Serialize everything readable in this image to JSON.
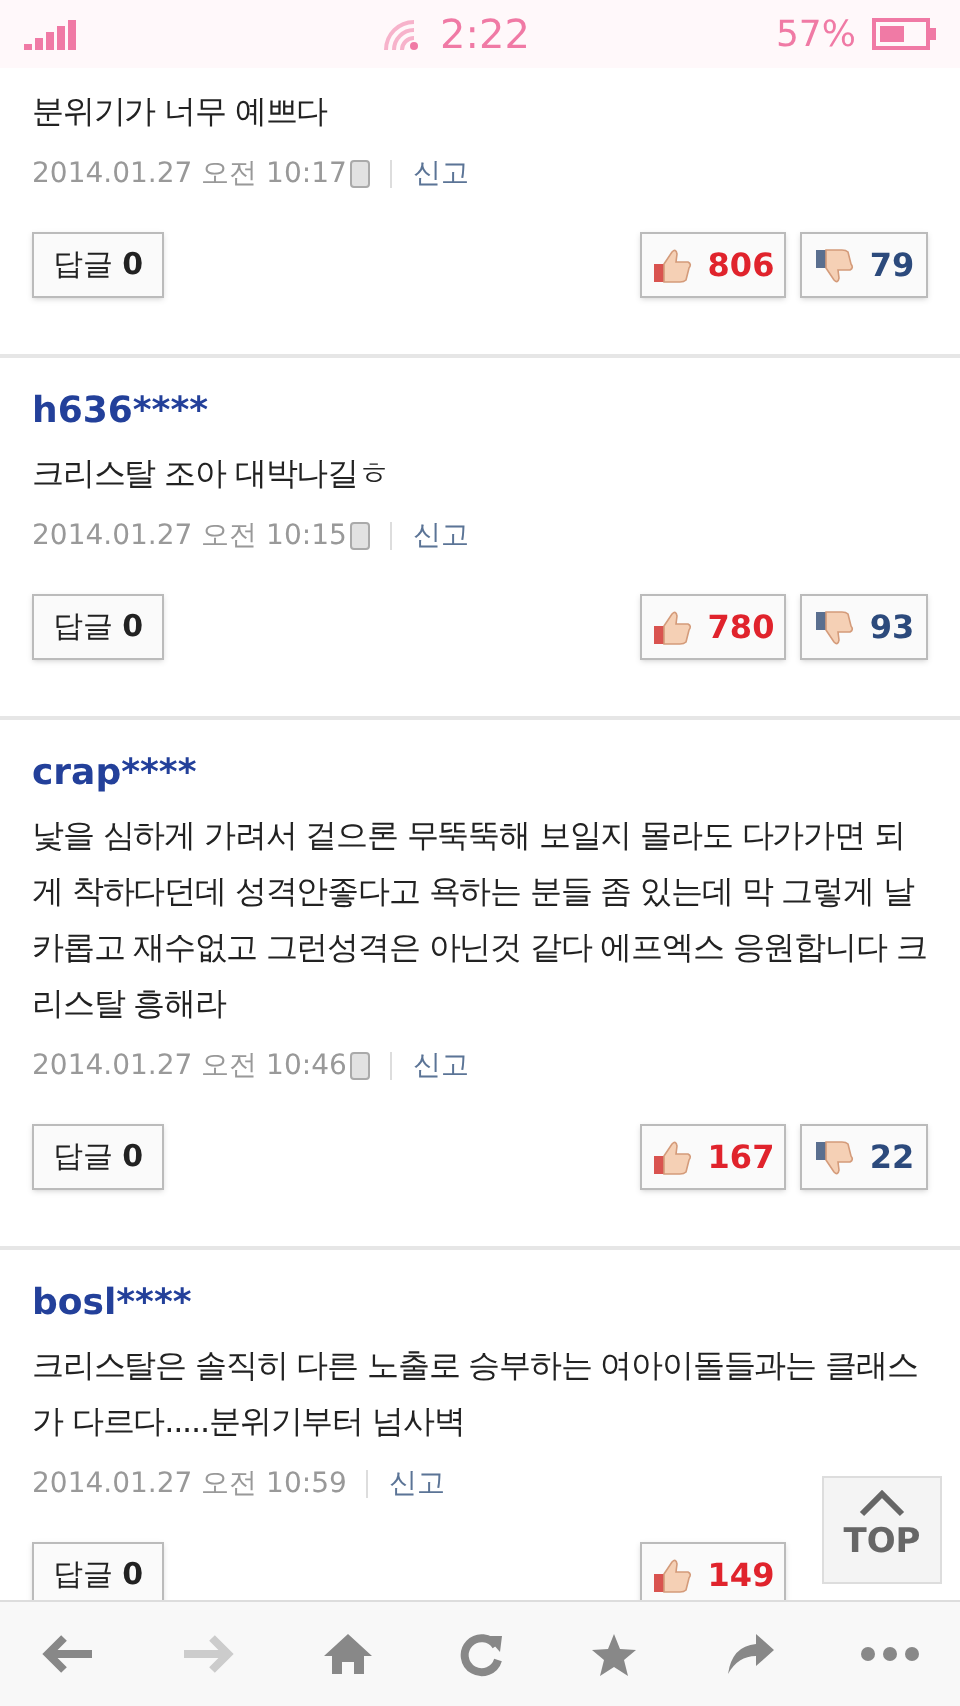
{
  "status_bar": {
    "time": "2:22",
    "battery": "57%"
  },
  "comments": [
    {
      "text": "분위기가 너무 예쁘다",
      "date": "2014.01.27 오전 10:17",
      "mobile": true,
      "report": "신고",
      "reply_label": "답글",
      "reply_count": "0",
      "likes": "806",
      "dislikes": "79"
    },
    {
      "user": "h636****",
      "text": "크리스탈 조아 대박나길ㅎ",
      "date": "2014.01.27 오전 10:15",
      "mobile": true,
      "report": "신고",
      "reply_label": "답글",
      "reply_count": "0",
      "likes": "780",
      "dislikes": "93"
    },
    {
      "user": "crap****",
      "text": "낯을 심하게 가려서 겉으론 무뚝뚝해 보일지 몰라도 다가가면 되게 착하다던데 성격안좋다고 욕하는 분들 좀 있는데 막 그렇게 날카롭고 재수없고 그런성격은 아닌것 같다 에프엑스 응원합니다 크리스탈 흥해라",
      "date": "2014.01.27 오전 10:46",
      "mobile": true,
      "report": "신고",
      "reply_label": "답글",
      "reply_count": "0",
      "likes": "167",
      "dislikes": "22"
    },
    {
      "user": "bosl****",
      "text": "크리스탈은 솔직히 다른 노출로 승부하는 여아이돌들과는 클래스가 다르다.....분위기부터 넘사벽",
      "date": "2014.01.27 오전 10:59",
      "mobile": false,
      "report": "신고",
      "reply_label": "답글",
      "reply_count": "0",
      "likes": "149"
    }
  ],
  "top_button": {
    "label": "TOP"
  }
}
